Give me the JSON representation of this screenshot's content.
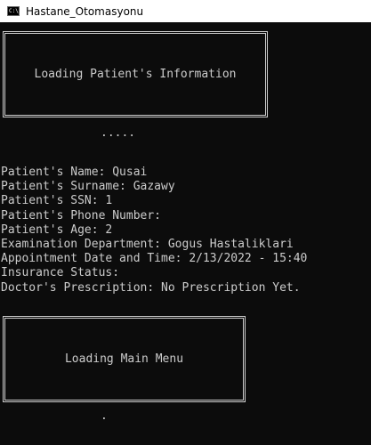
{
  "window": {
    "title": "Hastane_Otomasyonu",
    "icon": "console-icon",
    "icon_text": "C:\\"
  },
  "console": {
    "loading_patient": "Loading Patient's Information",
    "progress_dots_top": ".....",
    "patient_info": [
      "Patient's Name: Qusai",
      "Patient's Surname: Gazawy",
      "Patient's SSN: 1",
      "Patient's Phone Number:",
      "Patient's Age: 2",
      "Examination Department: Gogus Hastaliklari",
      "Appointment Date and Time: 2/13/2022 - 15:40",
      "Insurance Status:",
      "Doctor's Prescription: No Prescription Yet."
    ],
    "loading_menu": "Loading Main Menu",
    "progress_dots_bottom": "."
  },
  "colors": {
    "background": "#0c0c0c",
    "foreground": "#cccccc",
    "titlebar": "#ffffff"
  }
}
